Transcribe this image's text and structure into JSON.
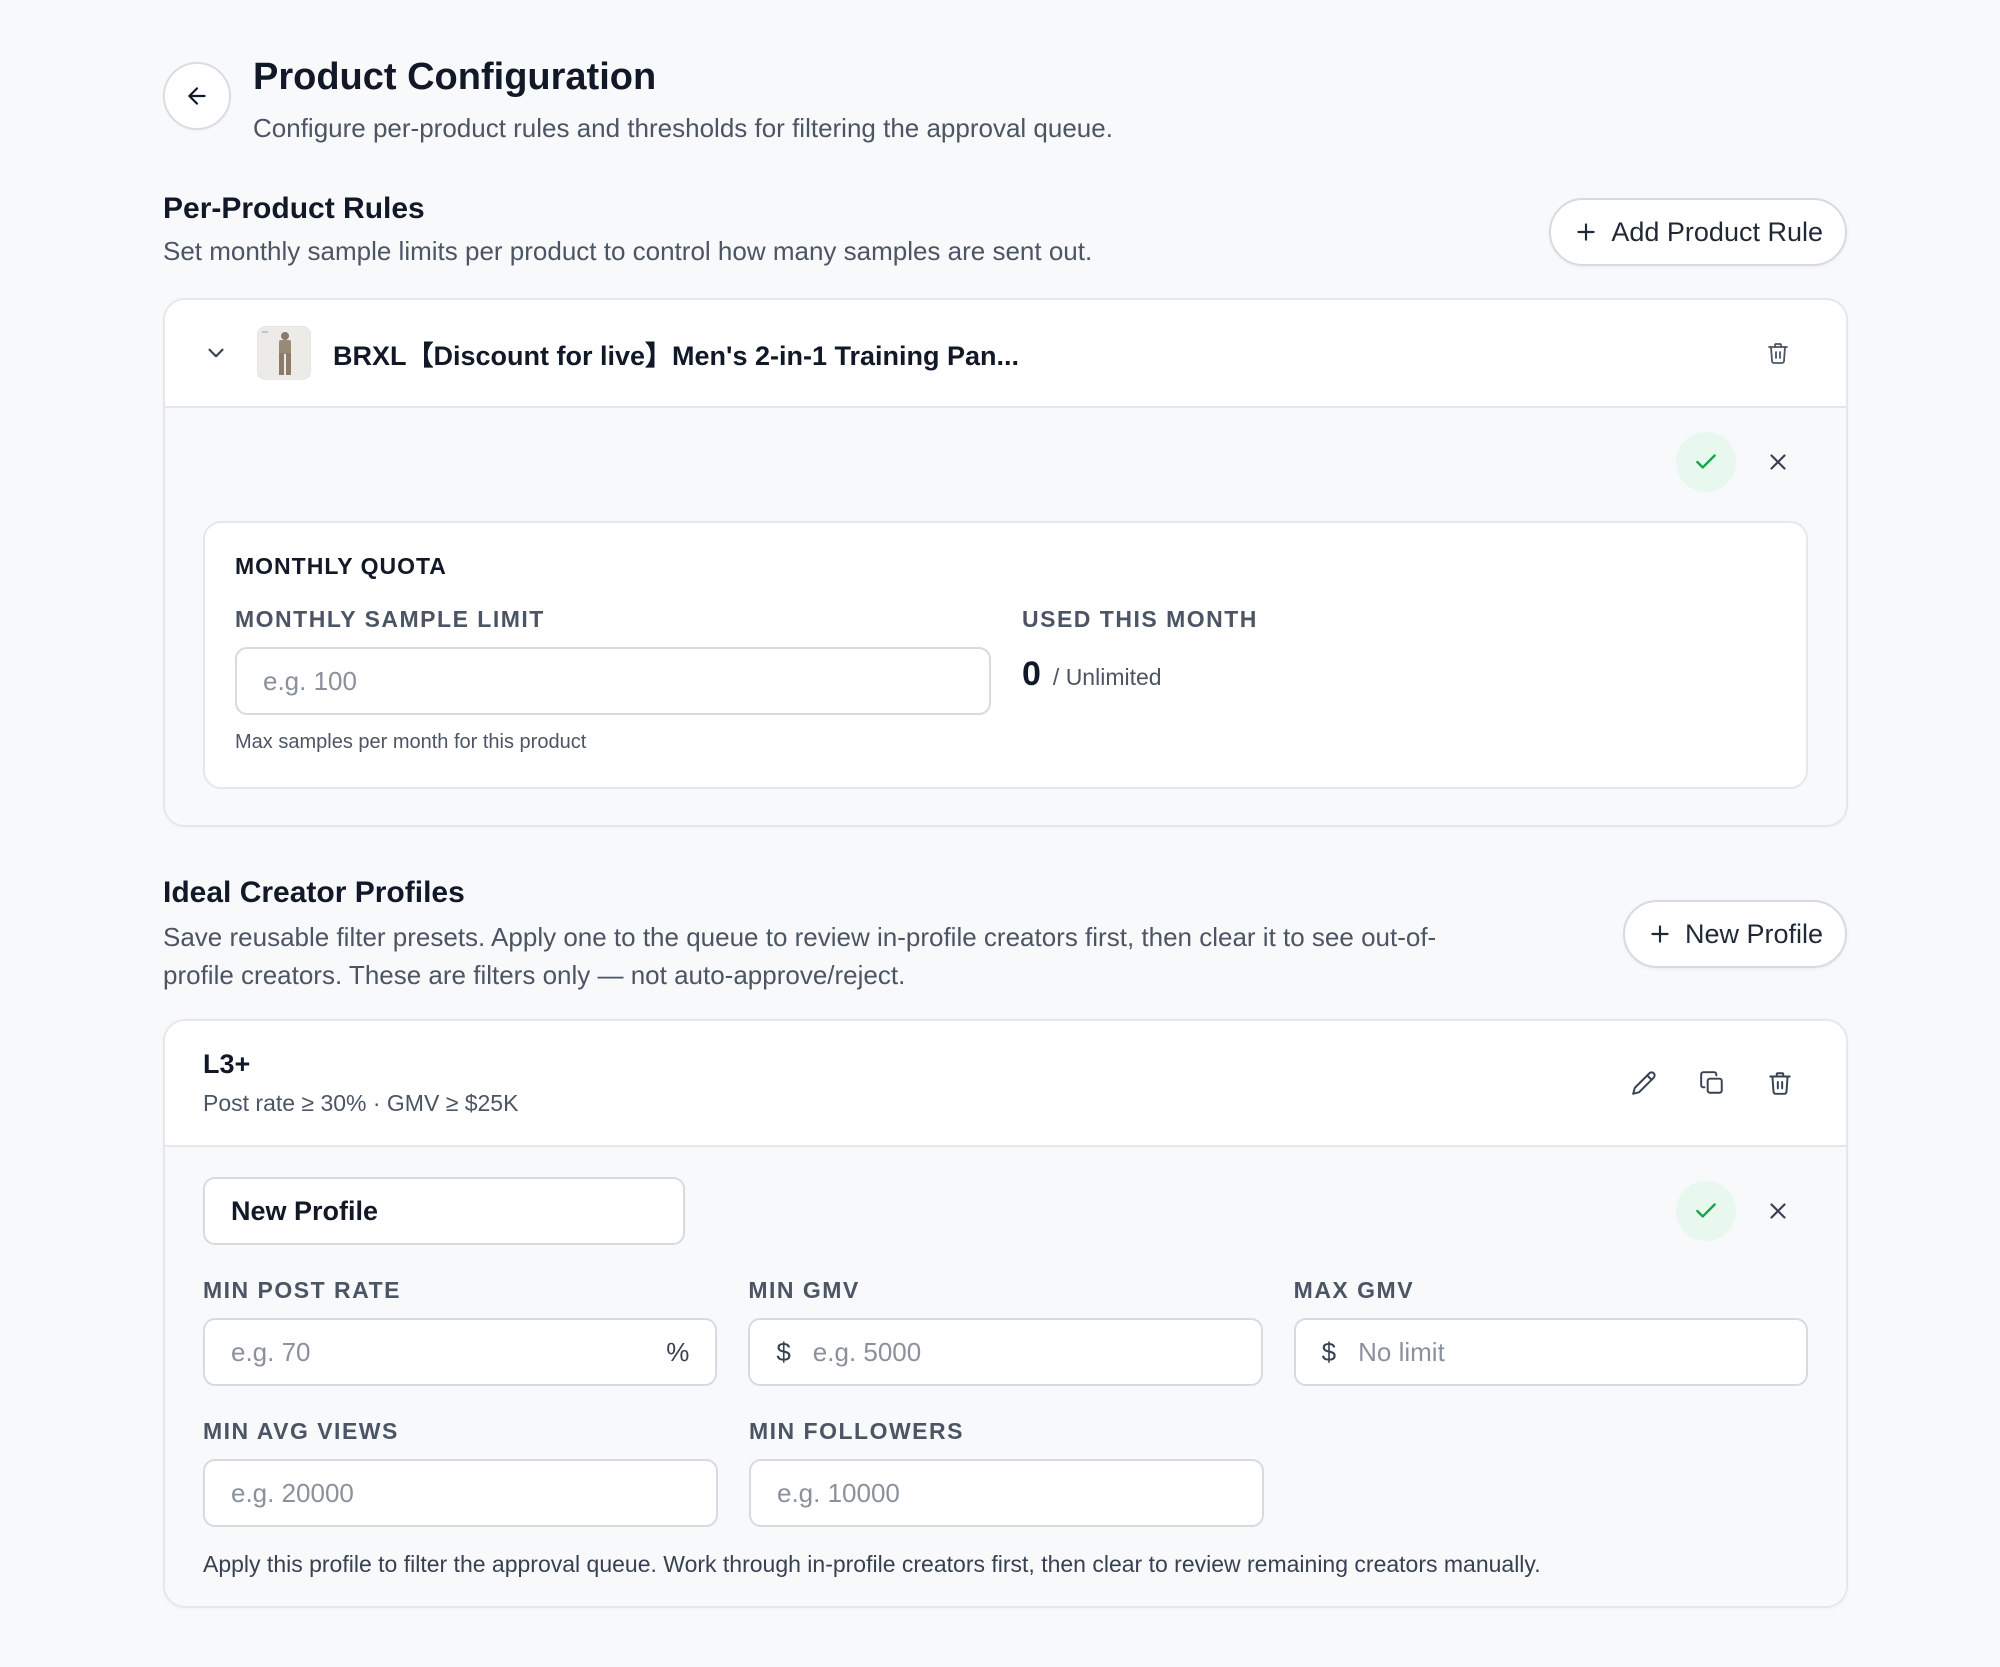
{
  "header": {
    "title": "Product Configuration",
    "subtitle": "Configure per-product rules and thresholds for filtering the approval queue."
  },
  "per_product_rules": {
    "title": "Per-Product Rules",
    "description": "Set monthly sample limits per product to control how many samples are sent out.",
    "add_button_label": "Add Product Rule",
    "product": {
      "name": "BRXL【Discount for live】Men's 2-in-1 Training Pan...",
      "quota": {
        "section_title": "MONTHLY QUOTA",
        "limit_label": "MONTHLY SAMPLE LIMIT",
        "limit_placeholder": "e.g. 100",
        "limit_helper": "Max samples per month for this product",
        "used_label": "USED THIS MONTH",
        "used_value": "0",
        "used_total": "/ Unlimited"
      }
    }
  },
  "creator_profiles": {
    "title": "Ideal Creator Profiles",
    "description_line1": "Save reusable filter presets. Apply one to the queue to review in-profile creators first, then clear it to see out-of-",
    "description_line2": "profile creators. These are filters only — not auto-approve/reject.",
    "new_button_label": "New Profile",
    "profile": {
      "name": "L3+",
      "summary": "Post rate ≥ 30% · GMV ≥ $25K"
    },
    "editor": {
      "name_value": "New Profile",
      "min_post_rate_label": "MIN POST RATE",
      "min_post_rate_placeholder": "e.g. 70",
      "min_post_rate_suffix": "%",
      "min_gmv_label": "MIN GMV",
      "min_gmv_prefix": "$",
      "min_gmv_placeholder": "e.g. 5000",
      "max_gmv_label": "MAX GMV",
      "max_gmv_prefix": "$",
      "max_gmv_placeholder": "No limit",
      "min_avg_views_label": "MIN AVG VIEWS",
      "min_avg_views_placeholder": "e.g. 20000",
      "min_followers_label": "MIN FOLLOWERS",
      "min_followers_placeholder": "e.g. 10000",
      "footer_note": "Apply this profile to filter the approval queue. Work through in-profile creators first, then clear to review remaining creators manually."
    }
  },
  "icons": {
    "back": "arrow-left-icon",
    "plus": "plus-icon",
    "chevron": "chevron-down-icon",
    "trash": "trash-icon",
    "check": "check-icon",
    "close": "close-icon",
    "edit": "pencil-icon",
    "duplicate": "copy-icon"
  },
  "colors": {
    "background": "#f8f9fb",
    "confirm_bg": "#e8f8ee",
    "confirm_icon": "#16a34a",
    "border": "#e5e7eb"
  }
}
